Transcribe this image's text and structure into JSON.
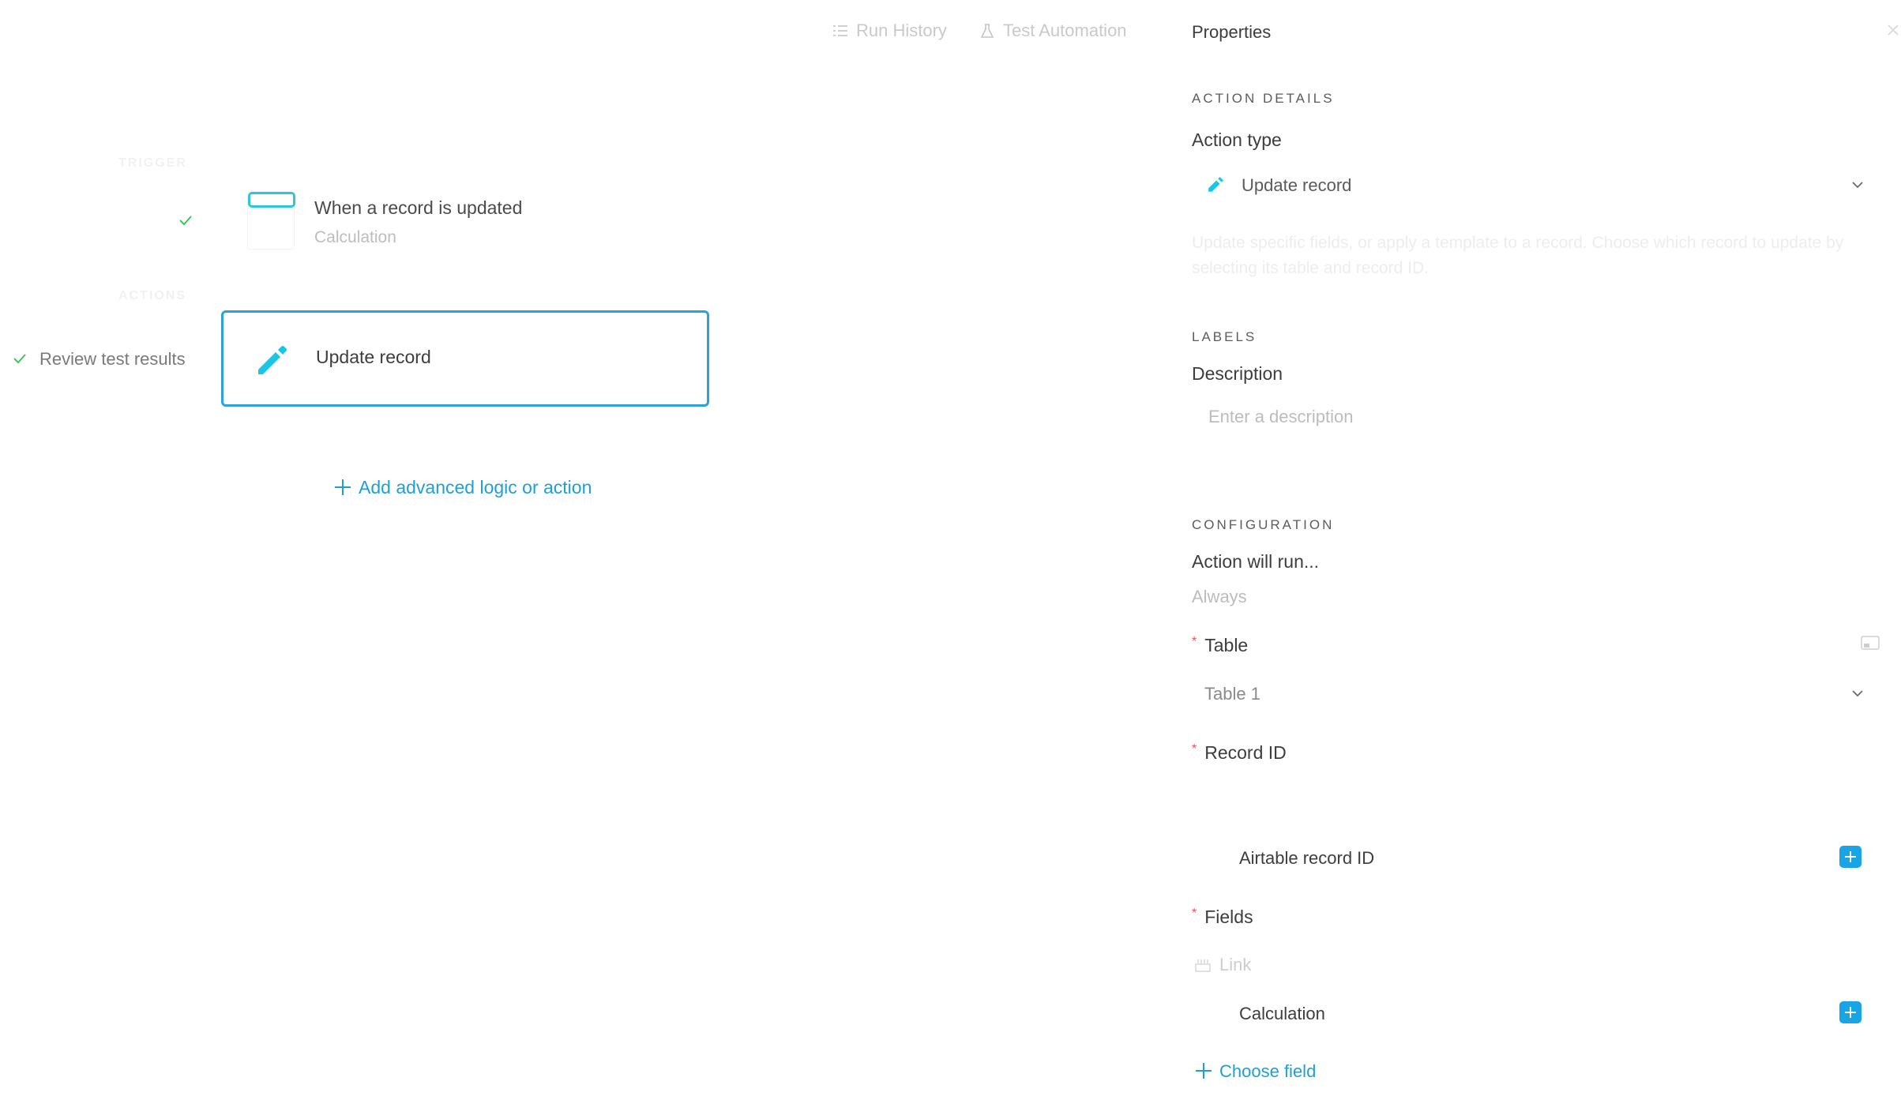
{
  "toolbar": {
    "run_history": "Run History",
    "test_automation": "Test Automation"
  },
  "canvas": {
    "trigger_section": "TRIGGER",
    "actions_section": "ACTIONS",
    "trigger": {
      "title": "When a record is updated",
      "subtitle": "Calculation"
    },
    "review_label": "Review test results",
    "action_card": {
      "title": "Update record"
    },
    "add_logic_label": "Add advanced logic or action"
  },
  "properties": {
    "title": "Properties",
    "action_details": {
      "heading": "ACTION DETAILS",
      "action_type_label": "Action type",
      "action_type_value": "Update record",
      "description": "Update specific fields, or apply a template to a record. Choose which record to update by selecting its table and record ID."
    },
    "labels": {
      "heading": "LABELS",
      "description_label": "Description",
      "description_placeholder": "Enter a description"
    },
    "configuration": {
      "heading": "CONFIGURATION",
      "run_label": "Action will run...",
      "run_value": "Always",
      "table_label": "Table",
      "table_value": "Table 1",
      "record_id_label": "Record ID",
      "record_id_token": "Airtable record ID",
      "fields_label": "Fields",
      "field_name": "Link",
      "field_token": "Calculation",
      "choose_field_label": "Choose field"
    }
  },
  "colors": {
    "accent": "#1e9fd7",
    "card_border": "#2ca2d8",
    "trigger_icon": "#2dc7dc",
    "pencil": "#19c6e6",
    "check": "#3ec45a",
    "required": "#e25555"
  },
  "icons": [
    "list-icon",
    "flask-icon",
    "calendar-icon",
    "pencil-icon",
    "check-icon",
    "chevron-down-icon",
    "close-icon",
    "expand-icon",
    "link-field-icon",
    "plus-icon"
  ]
}
